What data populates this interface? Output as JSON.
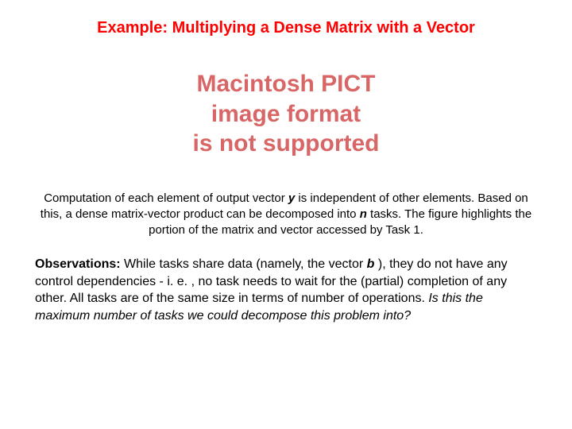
{
  "title": "Example: Multiplying a Dense Matrix with a Vector",
  "placeholder": {
    "line1": "Macintosh PICT",
    "line2": "image format",
    "line3": "is not supported"
  },
  "caption": {
    "t1": "Computation of each element of output vector ",
    "y": "y",
    "t2": " is independent of other elements. Based on this, a dense matrix-vector product can be decomposed into ",
    "n": "n",
    "t3": " tasks. The figure highlights the portion of the matrix and vector accessed by Task 1."
  },
  "body": {
    "lead": "Observations:",
    "t1": " While tasks share data (namely, the vector ",
    "b": "b",
    "t2": " ), they do not have any control dependencies - i. e. , no task needs to wait for the (partial) completion of any other. All tasks are of the same size in terms of number of operations. ",
    "question": "Is this the maximum number of tasks we could decompose this problem into?"
  }
}
